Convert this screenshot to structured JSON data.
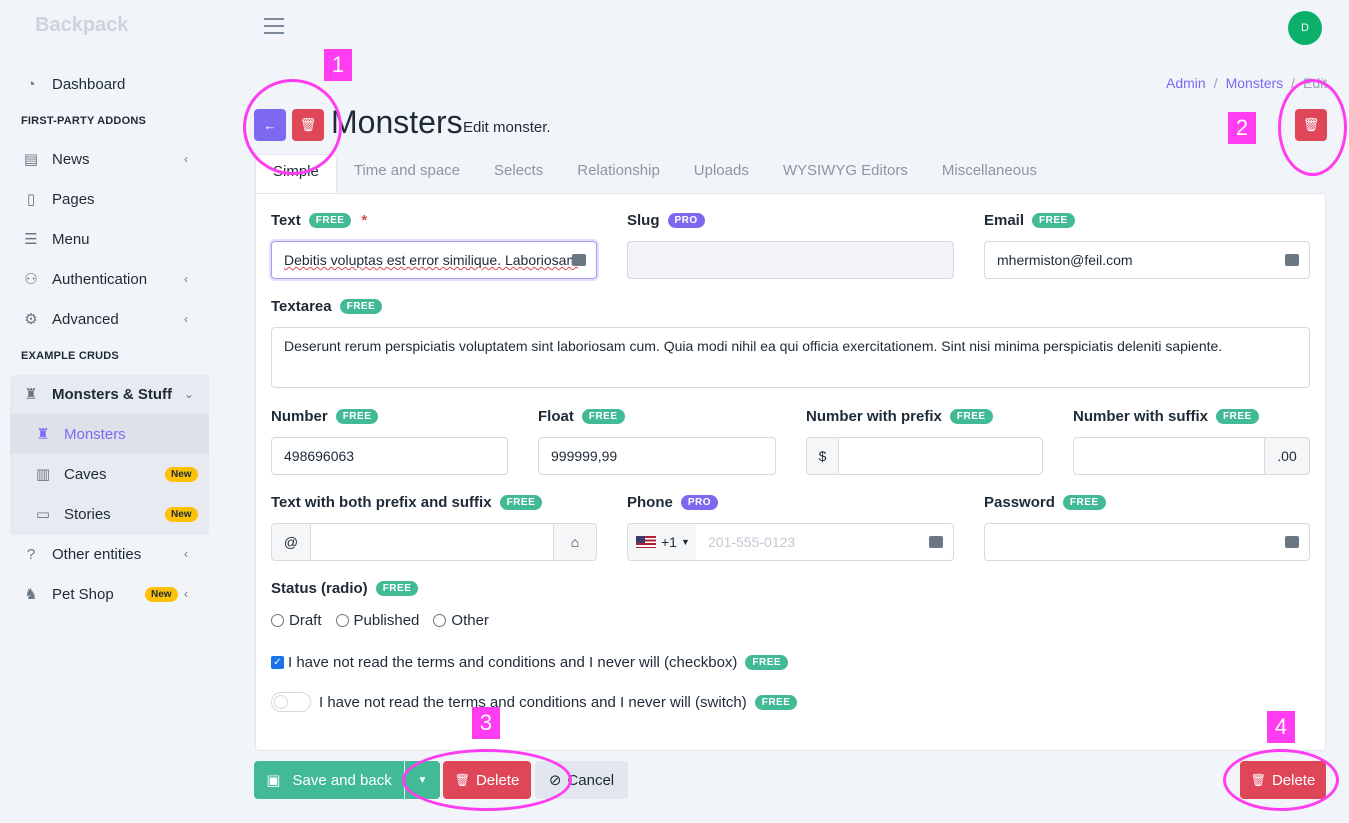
{
  "brand": "Backpack",
  "header": {
    "avatar_initial": "D"
  },
  "sidebar": {
    "dashboard": "Dashboard",
    "heading_addons": "FIRST-PARTY ADDONS",
    "news": "News",
    "pages": "Pages",
    "menu": "Menu",
    "authentication": "Authentication",
    "advanced": "Advanced",
    "heading_cruds": "EXAMPLE CRUDS",
    "monsters_stuff": "Monsters & Stuff",
    "monsters": "Monsters",
    "caves": "Caves",
    "stories": "Stories",
    "other_entities": "Other entities",
    "pet_shop": "Pet Shop",
    "new_badge": "New"
  },
  "breadcrumb": {
    "admin": "Admin",
    "sep": "/",
    "monsters": "Monsters",
    "edit": "Edit"
  },
  "page": {
    "title": "Monsters",
    "subtitle": "Edit monster."
  },
  "tabs": [
    "Simple",
    "Time and space",
    "Selects",
    "Relationship",
    "Uploads",
    "WYSIWYG Editors",
    "Miscellaneous"
  ],
  "badges": {
    "free": "FREE",
    "pro": "PRO",
    "required": "*"
  },
  "form": {
    "text_label": "Text",
    "text_value": "Debitis voluptas est error similique. Laboriosam",
    "slug_label": "Slug",
    "email_label": "Email",
    "email_value": "mhermiston@feil.com",
    "textarea_label": "Textarea",
    "textarea_value": "Deserunt rerum perspiciatis voluptatem sint laboriosam cum. Quia modi nihil ea qui officia exercitationem. Sint nisi minima perspiciatis deleniti sapiente.",
    "number_label": "Number",
    "number_value": "498696063",
    "float_label": "Float",
    "float_value": "999999,99",
    "number_prefix_label": "Number with prefix",
    "prefix_symbol": "$",
    "number_suffix_label": "Number with suffix",
    "suffix_symbol": ".00",
    "both_label": "Text with both prefix and suffix",
    "both_prefix": "@",
    "phone_label": "Phone",
    "phone_code": "+1",
    "phone_placeholder": "201-555-0123",
    "password_label": "Password",
    "status_label": "Status (radio)",
    "radio_options": [
      "Draft",
      "Published",
      "Other"
    ],
    "checkbox_label": "I have not read the terms and conditions and I never will (checkbox)",
    "switch_label": "I have not read the terms and conditions and I never will (switch)"
  },
  "actions": {
    "save": "Save and back",
    "delete": "Delete",
    "cancel": "Cancel"
  },
  "annotations": [
    "1",
    "2",
    "3",
    "4"
  ],
  "colors": {
    "accent": "#7c69ef",
    "danger": "#df4759",
    "success": "#42ba96",
    "highlight": "#ff3cf0"
  }
}
